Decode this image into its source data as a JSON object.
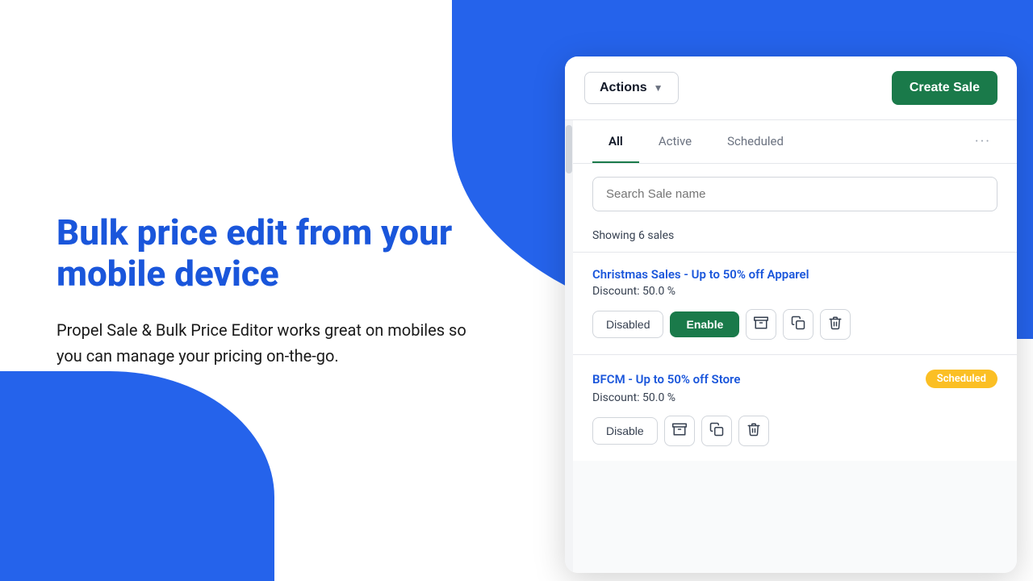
{
  "background": {
    "top_color": "#2563eb",
    "bottom_color": "#2563eb"
  },
  "hero": {
    "title": "Bulk price edit from your mobile device",
    "description": "Propel Sale & Bulk Price Editor works great on mobiles so you can manage your pricing on-the-go."
  },
  "toolbar": {
    "actions_label": "Actions",
    "create_sale_label": "Create Sale"
  },
  "tabs": [
    {
      "label": "All",
      "active": true
    },
    {
      "label": "Active",
      "active": false
    },
    {
      "label": "Scheduled",
      "active": false
    }
  ],
  "tab_more": "···",
  "search": {
    "placeholder": "Search Sale name"
  },
  "showing": {
    "text": "Showing 6 sales"
  },
  "sales": [
    {
      "name": "Christmas Sales - Up to 50% off Apparel",
      "discount": "Discount: 50.0 %",
      "status": "disabled",
      "badge": null,
      "actions": {
        "primary_btn": "Enable",
        "secondary_btn": "Disabled"
      }
    },
    {
      "name": "BFCM - Up to 50% off Store",
      "discount": "Discount: 50.0 %",
      "status": "scheduled",
      "badge": "Scheduled",
      "actions": {
        "primary_btn": null,
        "secondary_btn": "Disable"
      }
    }
  ],
  "icons": {
    "archive": "🗂",
    "copy": "⧉",
    "trash": "🗑"
  }
}
